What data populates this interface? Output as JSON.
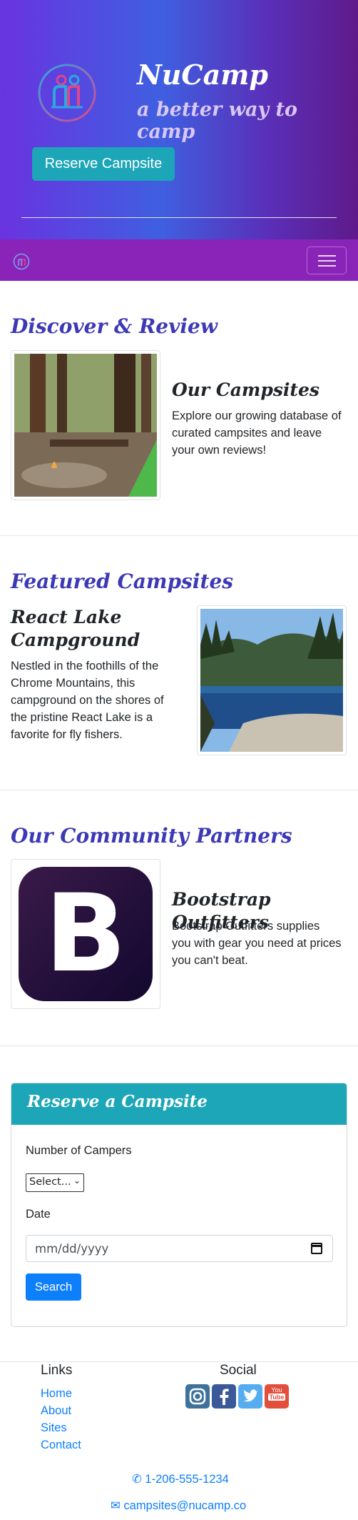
{
  "header": {
    "brand_title": "NuCamp",
    "brand_subtitle": "a better way to camp",
    "reserve_button_label": "Reserve Campsite"
  },
  "navbar": {
    "logo_icon": "nucamp-logo-icon",
    "toggler_icon": "hamburger-menu-icon"
  },
  "discover": {
    "section_title": "Discover & Review",
    "media_title": "Our Campsites",
    "media_text_lines": [
      "Explore our growing database of",
      "curated campsites and leave",
      "your own reviews!"
    ],
    "image_description": "campfire-in-forest-image"
  },
  "featured": {
    "section_title": "Featured Campsites",
    "media_title_lines": [
      "React Lake",
      "Campground"
    ],
    "media_text_lines": [
      "Nestled in the foothills of the",
      "Chrome Mountains, this",
      "campground on the shores of",
      "the pristine React Lake is a",
      "favorite for fly fishers."
    ]
  },
  "partners": {
    "section_title": "Our Community Partners",
    "media_title": "Bootstrap Outfitters",
    "media_text_lines": [
      "Bootstrap Outfitters supplies",
      "you with gear you need at prices",
      "you can't beat."
    ],
    "logo_letter": "B"
  },
  "reserve_form": {
    "card_title": "Reserve a Campsite",
    "campers_label": "Number of Campers",
    "campers_selected": "Select...",
    "date_label": "Date",
    "date_placeholder": "mm/dd/yyyy",
    "search_button_label": "Search"
  },
  "footer": {
    "links_heading": "Links",
    "links": [
      "Home",
      "About",
      "Sites",
      "Contact"
    ],
    "social_heading": "Social",
    "social_icons": [
      "instagram-icon",
      "facebook-icon",
      "twitter-icon",
      "youtube-icon"
    ],
    "phone": "1-206-555-1234",
    "email": "campsites@nucamp.co"
  },
  "colors": {
    "accent_teal": "#1ca6b7",
    "navbar_purple": "#8a23b8",
    "title_blue": "#3d39b6",
    "link_blue": "#0d7ffb"
  }
}
